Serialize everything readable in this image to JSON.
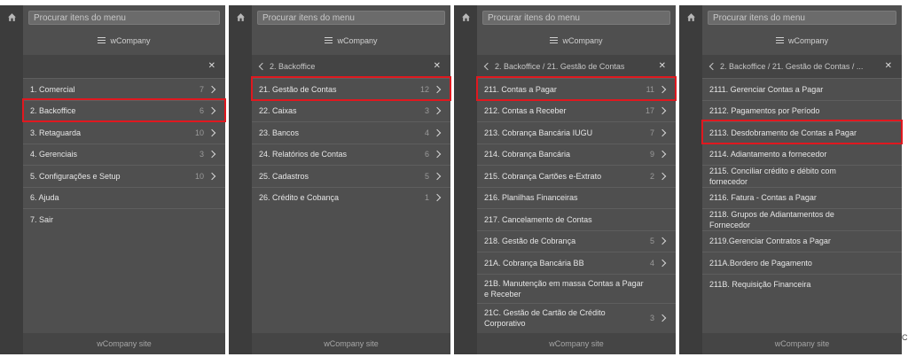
{
  "search_placeholder": "Procurar itens do menu",
  "brand": "wCompany",
  "footer": "wCompany site",
  "panels": [
    {
      "header": "",
      "items": [
        {
          "label": "1. Comercial",
          "count": "7",
          "chevron": true
        },
        {
          "label": "2. Backoffice",
          "count": "6",
          "chevron": true
        },
        {
          "label": "3. Retaguarda",
          "count": "10",
          "chevron": true
        },
        {
          "label": "4. Gerenciais",
          "count": "3",
          "chevron": true
        },
        {
          "label": "5. Configurações e Setup",
          "count": "10",
          "chevron": true
        },
        {
          "label": "6. Ajuda",
          "count": "",
          "chevron": false
        },
        {
          "label": "7. Sair",
          "count": "",
          "chevron": false
        }
      ]
    },
    {
      "header": "2. Backoffice",
      "items": [
        {
          "label": "21. Gestão de Contas",
          "count": "12",
          "chevron": true
        },
        {
          "label": "22. Caixas",
          "count": "3",
          "chevron": true
        },
        {
          "label": "23. Bancos",
          "count": "4",
          "chevron": true
        },
        {
          "label": "24. Relatórios de Contas",
          "count": "6",
          "chevron": true
        },
        {
          "label": "25. Cadastros",
          "count": "5",
          "chevron": true
        },
        {
          "label": "26. Crédito e Cobança",
          "count": "1",
          "chevron": true
        }
      ]
    },
    {
      "header": "2. Backoffice / 21. Gestão de Contas",
      "items": [
        {
          "label": "211. Contas a Pagar",
          "count": "11",
          "chevron": true
        },
        {
          "label": "212. Contas a Receber",
          "count": "17",
          "chevron": true
        },
        {
          "label": "213. Cobrança Bancária IUGU",
          "count": "7",
          "chevron": true
        },
        {
          "label": "214. Cobrança Bancária",
          "count": "9",
          "chevron": true
        },
        {
          "label": "215. Cobrança Cartões e-Extrato",
          "count": "2",
          "chevron": true
        },
        {
          "label": "216. Planilhas Financeiras",
          "count": "",
          "chevron": false
        },
        {
          "label": "217. Cancelamento de Contas",
          "count": "",
          "chevron": false
        },
        {
          "label": "218. Gestão de Cobrança",
          "count": "5",
          "chevron": true
        },
        {
          "label": "21A. Cobrança Bancária BB",
          "count": "4",
          "chevron": true
        },
        {
          "label": "21B. Manutenção em massa Contas a Pagar e Receber",
          "count": "",
          "chevron": false
        },
        {
          "label": "21C. Gestão de Cartão de Crédito Corporativo",
          "count": "3",
          "chevron": true
        }
      ]
    },
    {
      "header": "2. Backoffice / 21. Gestão de Contas / ...",
      "items": [
        {
          "label": "2111. Gerenciar Contas a Pagar",
          "count": "",
          "chevron": false
        },
        {
          "label": "2112. Pagamentos por Período",
          "count": "",
          "chevron": false
        },
        {
          "label": "2113. Desdobramento de Contas a Pagar",
          "count": "",
          "chevron": false
        },
        {
          "label": "2114. Adiantamento a fornecedor",
          "count": "",
          "chevron": false
        },
        {
          "label": "2115. Conciliar crédito e débito com fornecedor",
          "count": "",
          "chevron": false
        },
        {
          "label": "2116. Fatura - Contas a Pagar",
          "count": "",
          "chevron": false
        },
        {
          "label": "2118. Grupos de Adiantamentos de Fornecedor",
          "count": "",
          "chevron": false
        },
        {
          "label": "2119.Gerenciar Contratos a Pagar",
          "count": "",
          "chevron": false
        },
        {
          "label": "211A.Bordero de Pagamento",
          "count": "",
          "chevron": false
        },
        {
          "label": "211B. Requisição Financeira",
          "count": "",
          "chevron": false
        }
      ]
    }
  ],
  "highlighted": [
    "2. Backoffice",
    "21. Gestão de Contas",
    "211. Contas a Pagar",
    "2113. Desdobramento de Contas a Pagar"
  ],
  "highlight_color": "#e0181f",
  "edge_glyph": "C"
}
